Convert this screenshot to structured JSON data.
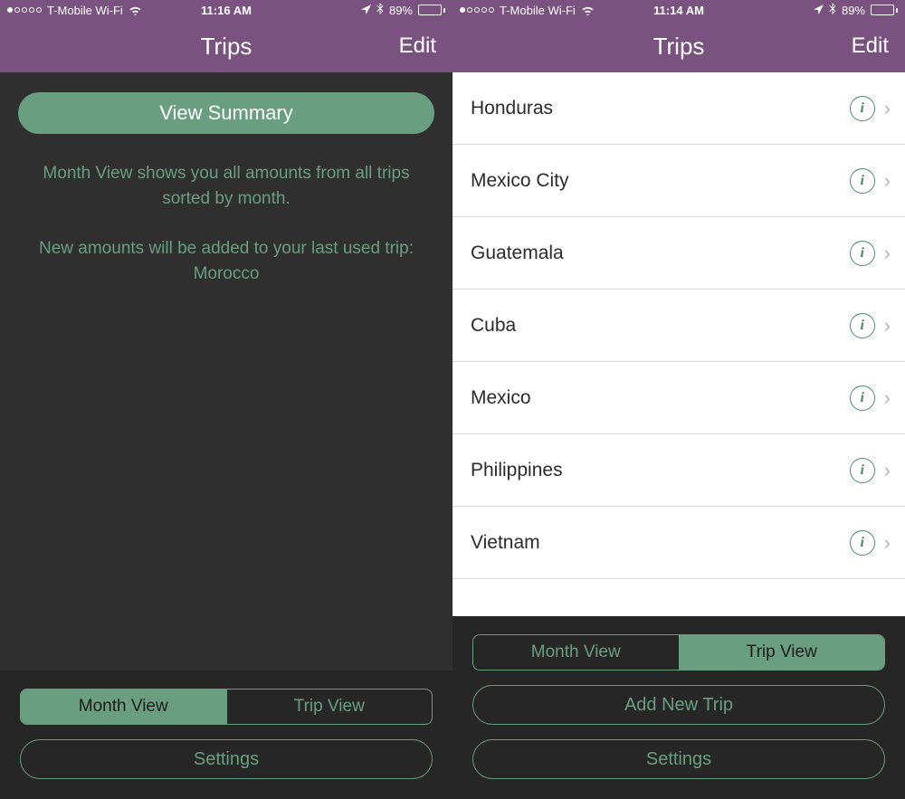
{
  "left": {
    "status": {
      "carrier": "T-Mobile Wi-Fi",
      "time": "11:16 AM",
      "battery_pct": "89%"
    },
    "nav": {
      "title": "Trips",
      "edit": "Edit"
    },
    "summary_button": "View Summary",
    "info_line1": "Month View shows you all amounts from all trips sorted by month.",
    "info_line2": "New amounts will be added to your last used trip: Morocco",
    "segment": {
      "month": "Month View",
      "trip": "Trip View",
      "active": "month"
    },
    "settings": "Settings"
  },
  "right": {
    "status": {
      "carrier": "T-Mobile Wi-Fi",
      "time": "11:14 AM",
      "battery_pct": "89%"
    },
    "nav": {
      "title": "Trips",
      "edit": "Edit"
    },
    "trips": [
      {
        "name": "Honduras"
      },
      {
        "name": "Mexico City"
      },
      {
        "name": "Guatemala"
      },
      {
        "name": "Cuba"
      },
      {
        "name": "Mexico"
      },
      {
        "name": "Philippines"
      },
      {
        "name": "Vietnam"
      }
    ],
    "segment": {
      "month": "Month View",
      "trip": "Trip View",
      "active": "trip"
    },
    "add_new": "Add New Trip",
    "settings": "Settings"
  },
  "icons": {
    "info_glyph": "i",
    "chevron": "›"
  }
}
